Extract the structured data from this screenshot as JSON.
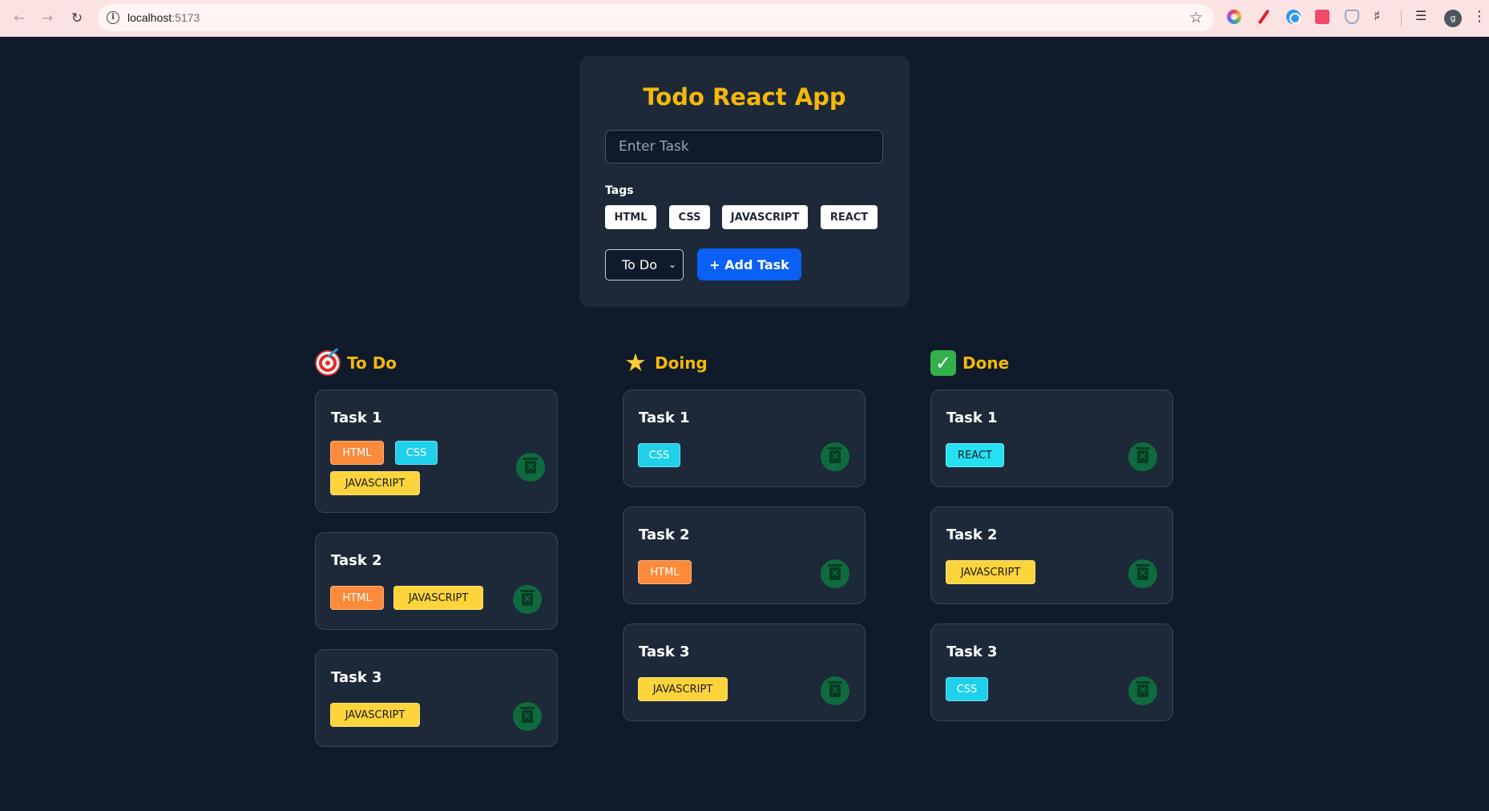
{
  "browser": {
    "url_host": "localhost",
    "url_port": ":5173",
    "avatar_letter": "g"
  },
  "app": {
    "title": "Todo React App",
    "input_placeholder": "Enter Task",
    "input_value": "",
    "tags_label": "Tags",
    "tag_options": [
      "HTML",
      "CSS",
      "JAVASCRIPT",
      "REACT"
    ],
    "status_selected": "To Do",
    "add_button": "+ Add Task"
  },
  "columns": [
    {
      "title": "To Do",
      "icon": "target-icon",
      "tasks": [
        {
          "title": "Task 1",
          "tags": [
            "HTML",
            "CSS",
            "JAVASCRIPT"
          ]
        },
        {
          "title": "Task 2",
          "tags": [
            "HTML",
            "JAVASCRIPT"
          ]
        },
        {
          "title": "Task 3",
          "tags": [
            "JAVASCRIPT"
          ]
        }
      ]
    },
    {
      "title": "Doing",
      "icon": "glowing-star-icon",
      "tasks": [
        {
          "title": "Task 1",
          "tags": [
            "CSS"
          ]
        },
        {
          "title": "Task 2",
          "tags": [
            "HTML"
          ]
        },
        {
          "title": "Task 3",
          "tags": [
            "JAVASCRIPT"
          ]
        }
      ]
    },
    {
      "title": "Done",
      "icon": "check-mark-icon",
      "tasks": [
        {
          "title": "Task 1",
          "tags": [
            "REACT"
          ]
        },
        {
          "title": "Task 2",
          "tags": [
            "JAVASCRIPT"
          ]
        },
        {
          "title": "Task 3",
          "tags": [
            "CSS"
          ]
        }
      ]
    }
  ],
  "colors": {
    "background": "#0f1a2b",
    "card": "#1d2939",
    "accent": "#f5b80b",
    "primary_button": "#0a5ff5",
    "tag_html": "#fb8a3a",
    "tag_css": "#1fd0ea",
    "tag_javascript": "#fdd43b",
    "tag_react": "#24e0f2",
    "delete_button": "#0f6b3f"
  }
}
